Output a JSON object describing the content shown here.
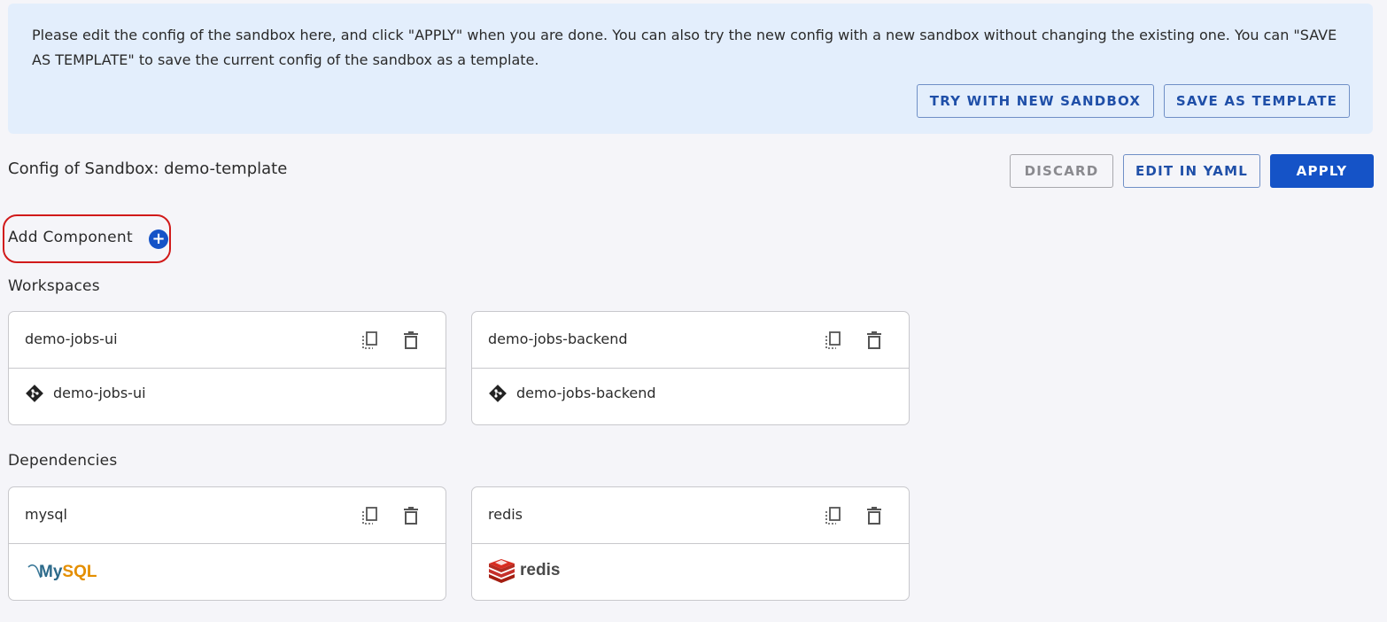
{
  "banner": {
    "text": "Please edit the config of the sandbox here, and click \"APPLY\" when you are done. You can also try the new config with a new sandbox without changing the existing one. You can \"SAVE AS TEMPLATE\" to save the current config of the sandbox as a template.",
    "try_new_sandbox_label": "TRY WITH NEW SANDBOX",
    "save_as_template_label": "SAVE AS TEMPLATE"
  },
  "header": {
    "title": "Config of Sandbox: demo-template",
    "discard_label": "DISCARD",
    "edit_yaml_label": "EDIT IN YAML",
    "apply_label": "APPLY"
  },
  "add_component": {
    "label": "Add Component",
    "icon": "plus-circle-icon"
  },
  "workspaces": {
    "label": "Workspaces",
    "items": [
      {
        "name": "demo-jobs-ui",
        "repo": "demo-jobs-ui",
        "icon": "git-icon"
      },
      {
        "name": "demo-jobs-backend",
        "repo": "demo-jobs-backend",
        "icon": "git-icon"
      }
    ]
  },
  "dependencies": {
    "label": "Dependencies",
    "items": [
      {
        "name": "mysql",
        "logo": "mysql-logo",
        "logo_text": "MySQL"
      },
      {
        "name": "redis",
        "logo": "redis-logo",
        "logo_text": "redis"
      }
    ]
  },
  "colors": {
    "primary": "#1553c7",
    "banner_bg": "#e3eefc",
    "highlight": "#d11a1a",
    "page_bg": "#f5f5f9"
  }
}
